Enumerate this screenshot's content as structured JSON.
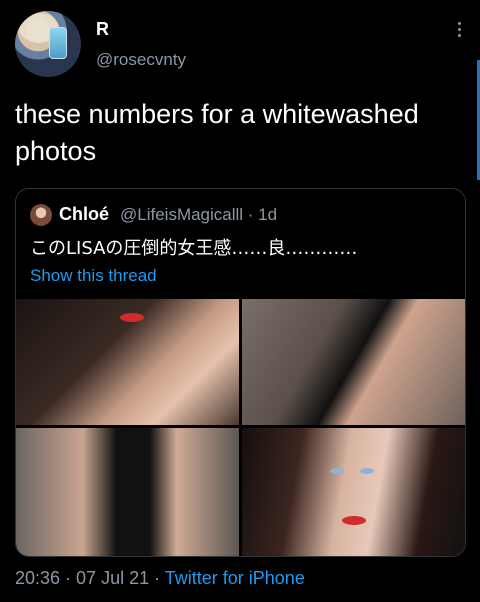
{
  "author": {
    "name": "R",
    "handle": "@rosecvnty"
  },
  "tweet": {
    "text": "these numbers for a whitewashed photos"
  },
  "quoted": {
    "name": "Chloé",
    "handle_time": "@LifeisMagicalll · 1d",
    "text": "このLISAの圧倒的女王感……良…………",
    "show_thread": "Show this thread",
    "photos": [
      "photo-1",
      "photo-2",
      "photo-3",
      "photo-4"
    ]
  },
  "footer": {
    "time_date": "20:36 · 07 Jul 21 · ",
    "source": "Twitter for iPhone"
  },
  "colors": {
    "background": "#000000",
    "secondary_text": "#8b98a5",
    "link": "#1d9bf0"
  },
  "icons": [
    "more-options-icon"
  ]
}
